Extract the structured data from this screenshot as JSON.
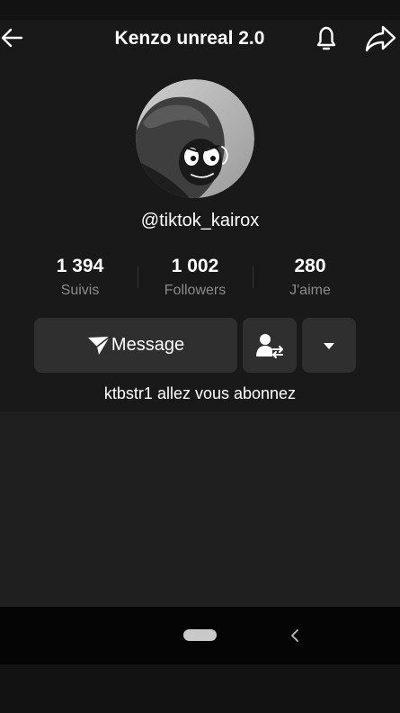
{
  "header": {
    "title": "Kenzo unreal 2.0",
    "icons": [
      "back-arrow-icon",
      "bell-icon",
      "share-icon"
    ]
  },
  "profile": {
    "username": "@tiktok_kairox",
    "avatar": "profile-photo-with-meme-face-sticker",
    "bio": "ktbstr1 allez vous abonnez"
  },
  "stats": [
    {
      "value": "1 394",
      "label": "Suivis"
    },
    {
      "value": "1 002",
      "label": "Followers"
    },
    {
      "value": "280",
      "label": "J'aime"
    }
  ],
  "actions": {
    "message_label": "Message",
    "message_icon": "send-icon",
    "friends_icon": "add-friend-swap-icon",
    "more_icon": "caret-down-icon"
  },
  "navigation": {
    "icons": [
      "home-pill-icon",
      "nav-back-icon"
    ]
  },
  "colors": {
    "background": "#121212",
    "panel": "#191919",
    "button": "#2f2f2f",
    "secondary_text": "#8b8b8b",
    "nav_bar": "#050505"
  }
}
